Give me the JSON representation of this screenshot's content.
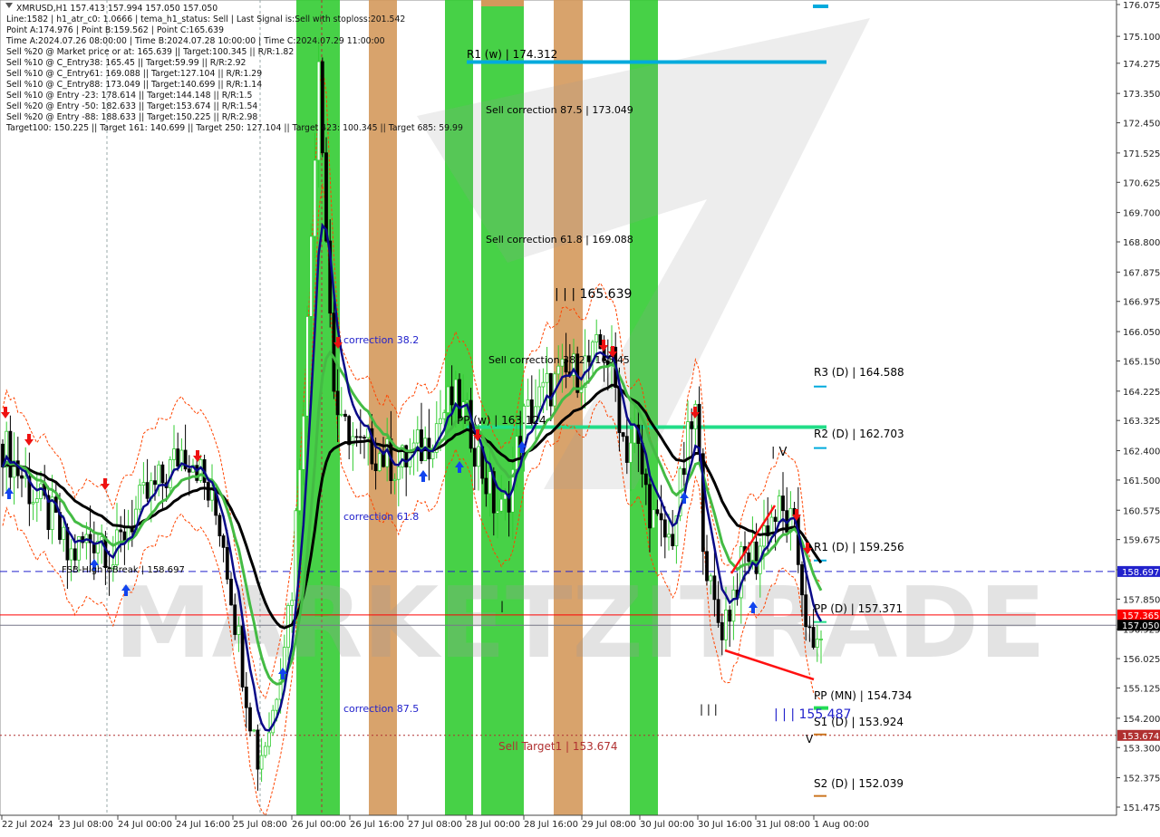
{
  "info_lines": [
    "XMRUSD,H1  157.413 157.994 157.050 157.050",
    "Line:1582 | h1_atr_c0: 1.0666 | tema_h1_status: Sell | Last Signal is:Sell with stoploss:201.542",
    "Point A:174.976 | Point B:159.562 | Point C:165.639",
    "Time A:2024.07.26 08:00:00 | Time B:2024.07.28 10:00:00 | Time C:2024.07.29 11:00:00",
    "Sell %20 @ Market price or at: 165.639 || Target:100.345 || R/R:1.82",
    "Sell %10 @ C_Entry38: 165.45 || Target:59.99 || R/R:2.92",
    "Sell %10 @ C_Entry61: 169.088 || Target:127.104 || R/R:1.29",
    "Sell %10 @ C_Entry88: 173.049 || Target:140.699 || R/R:1.14",
    "Sell %10 @ Entry -23: 178.614 || Target:144.148 || R/R:1.5",
    "Sell %20 @ Entry -50: 182.633 || Target:153.674 || R/R:1.54",
    "Sell %20 @ Entry -88: 188.633 || Target:150.225 || R/R:2.98",
    "Target100: 150.225 || Target 161: 140.699 || Target 250: 127.104 || Target 423: 100.345 || Target 685: 59.99"
  ],
  "watermark": "MARKETZITRADE",
  "chart_data": {
    "type": "line",
    "symbol": "XMRUSD",
    "timeframe": "H1",
    "ylim": [
      151.475,
      176.075
    ],
    "y_ticks": [
      "176.075",
      "175.100",
      "174.275",
      "173.350",
      "172.450",
      "171.525",
      "170.625",
      "169.700",
      "168.800",
      "167.875",
      "166.975",
      "166.050",
      "165.150",
      "164.225",
      "163.325",
      "162.400",
      "161.500",
      "160.575",
      "159.675",
      "158.750",
      "157.850",
      "156.925",
      "156.025",
      "155.125",
      "154.200",
      "153.300",
      "152.375",
      "151.475"
    ],
    "x_ticks": [
      "22 Jul 2024",
      "23 Jul 08:00",
      "24 Jul 00:00",
      "24 Jul 16:00",
      "25 Jul 08:00",
      "26 Jul 00:00",
      "26 Jul 16:00",
      "27 Jul 08:00",
      "28 Jul 00:00",
      "28 Jul 16:00",
      "29 Jul 08:00",
      "30 Jul 00:00",
      "30 Jul 16:00",
      "31 Jul 08:00",
      "1 Aug 00:00"
    ],
    "price_tags": [
      {
        "label": "158.697",
        "value": 158.697,
        "color": "#2222cc"
      },
      {
        "label": "157.365",
        "value": 157.365,
        "color": "#ff0000"
      },
      {
        "label": "157.050",
        "value": 157.05,
        "color": "#000000"
      },
      {
        "label": "153.674",
        "value": 153.674,
        "color": "#b03030"
      }
    ],
    "annotations": [
      {
        "text": "R1 (w) | 174.312",
        "value": 174.312,
        "color": "#000000"
      },
      {
        "text": "Sell correction 87.5 | 173.049",
        "value": 173.049,
        "color": "#000000"
      },
      {
        "text": "Sell correction 61.8 | 169.088",
        "value": 169.088,
        "color": "#000000"
      },
      {
        "text": "| | | 165.639",
        "value": 165.639,
        "color": "#000000"
      },
      {
        "text": "Sell correction 38.2 | 165.45",
        "value": 165.45,
        "color": "#000000"
      },
      {
        "text": "correction 38.2",
        "value": 166.0,
        "color": "#2222cc"
      },
      {
        "text": "PP (w) | 163.124",
        "value": 163.124,
        "color": "#000000"
      },
      {
        "text": "correction 61.8",
        "value": 160.4,
        "color": "#2222cc"
      },
      {
        "text": "FSB-HighToBreak | 158.697",
        "value": 158.697,
        "color": "#000000"
      },
      {
        "text": "correction 87.5",
        "value": 155.2,
        "color": "#2222cc"
      },
      {
        "text": "Sell Target1 | 153.674",
        "value": 153.674,
        "color": "#b03030"
      },
      {
        "text": "R3 (D) | 164.588",
        "value": 164.588,
        "color": "#000000"
      },
      {
        "text": "R2 (D) | 162.703",
        "value": 162.703,
        "color": "#000000"
      },
      {
        "text": "R1 (D) | 159.256",
        "value": 159.256,
        "color": "#000000"
      },
      {
        "text": "PP (D) | 157.371",
        "value": 157.371,
        "color": "#000000"
      },
      {
        "text": "PP (MN) | 154.734",
        "value": 154.734,
        "color": "#000000"
      },
      {
        "text": "S1 (D) | 153.924",
        "value": 153.924,
        "color": "#000000"
      },
      {
        "text": "S2 (D) | 152.039",
        "value": 152.039,
        "color": "#000000"
      },
      {
        "text": "| | | 155.487",
        "value": 155.487,
        "color": "#2222cc"
      },
      {
        "text": "| V",
        "value": 162.6,
        "color": "#000000"
      },
      {
        "text": "| | |",
        "value": 155.6,
        "color": "#000000"
      },
      {
        "text": "|",
        "value": 157.8,
        "color": "#000000"
      },
      {
        "text": "V",
        "value": 153.3,
        "color": "#000000"
      }
    ],
    "zone_colors": {
      "green": "#33cc33",
      "orange": "#d4995c"
    },
    "colors": {
      "bull": "#33cc33",
      "bear": "#000000",
      "ma_green": "#44bb44",
      "ma_navy": "#0a0a88",
      "ma_black": "#000000",
      "envelope": "#ff4400",
      "level_cyan": "#00aadd",
      "level_green": "#22dd88",
      "arrow_up": "#1144ee",
      "arrow_down": "#ee1111"
    }
  }
}
